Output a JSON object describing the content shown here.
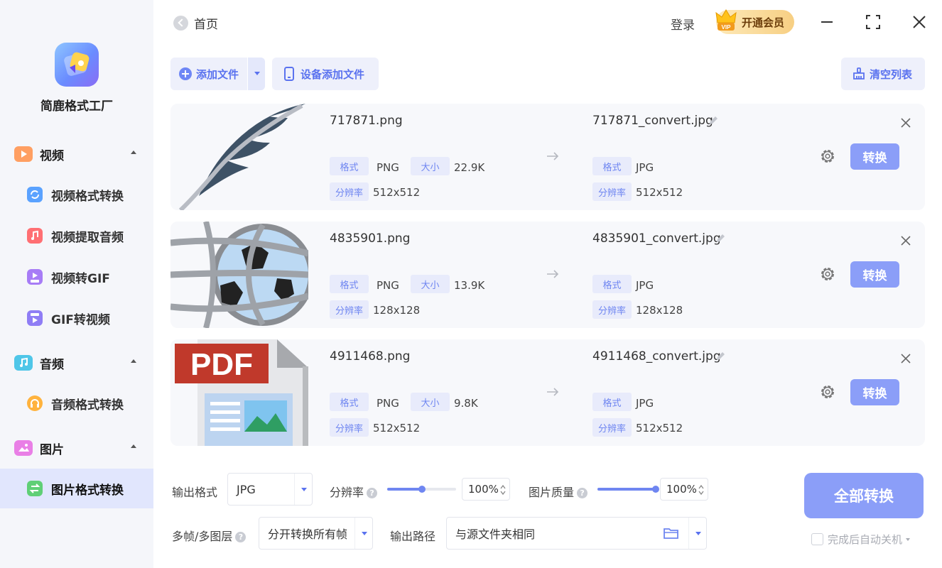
{
  "app": {
    "name": "简鹿格式工厂"
  },
  "header": {
    "back_label": "首页",
    "login_label": "登录",
    "vip_label": "开通会员",
    "vip_badge": "VIP"
  },
  "sidebar": {
    "groups": [
      {
        "label": "视频",
        "items": [
          "视频格式转换",
          "视频提取音频",
          "视频转GIF",
          "GIF转视频"
        ]
      },
      {
        "label": "音频",
        "items": [
          "音频格式转换"
        ]
      },
      {
        "label": "图片",
        "items": [
          "图片格式转换"
        ]
      }
    ],
    "active_item": "图片格式转换"
  },
  "toolbar": {
    "add_file": "添加文件",
    "device_add": "设备添加文件",
    "clear_list": "清空列表"
  },
  "labels": {
    "format": "格式",
    "size": "大小",
    "resolution": "分辨率",
    "convert": "转换"
  },
  "files": [
    {
      "name": "717871.png",
      "format": "PNG",
      "size": "22.9K",
      "resolution": "512x512",
      "out_name": "717871_convert.jpg",
      "out_format": "JPG",
      "out_resolution": "512x512",
      "thumb": "feather-quill-icon"
    },
    {
      "name": "4835901.png",
      "format": "PNG",
      "size": "13.9K",
      "resolution": "128x128",
      "out_name": "4835901_convert.jpg",
      "out_format": "JPG",
      "out_resolution": "128x128",
      "thumb": "globe-sphere-icon"
    },
    {
      "name": "4911468.png",
      "format": "PNG",
      "size": "9.8K",
      "resolution": "512x512",
      "out_name": "4911468_convert.jpg",
      "out_format": "JPG",
      "out_resolution": "512x512",
      "thumb": "pdf-document-icon",
      "thumb_text": "PDF"
    }
  ],
  "settings": {
    "output_format_label": "输出格式",
    "output_format_value": "JPG",
    "resolution_label": "分辨率",
    "resolution_value": "100%",
    "resolution_slider_fraction": 0.5,
    "quality_label": "图片质量",
    "quality_value": "100%",
    "quality_slider_fraction": 1.0,
    "multiframe_label": "多帧/多图层",
    "multiframe_value": "分开转换所有帧",
    "output_path_label": "输出路径",
    "output_path_value": "与源文件夹相同",
    "convert_all": "全部转换",
    "auto_shutdown": "完成后自动关机"
  },
  "colors": {
    "accent": "#6f86f1",
    "button": "#8b9ef8",
    "sidebar_bg": "#f5f6fa",
    "active_bg": "#e1e6fd",
    "row_bg": "#f7f8fb"
  }
}
